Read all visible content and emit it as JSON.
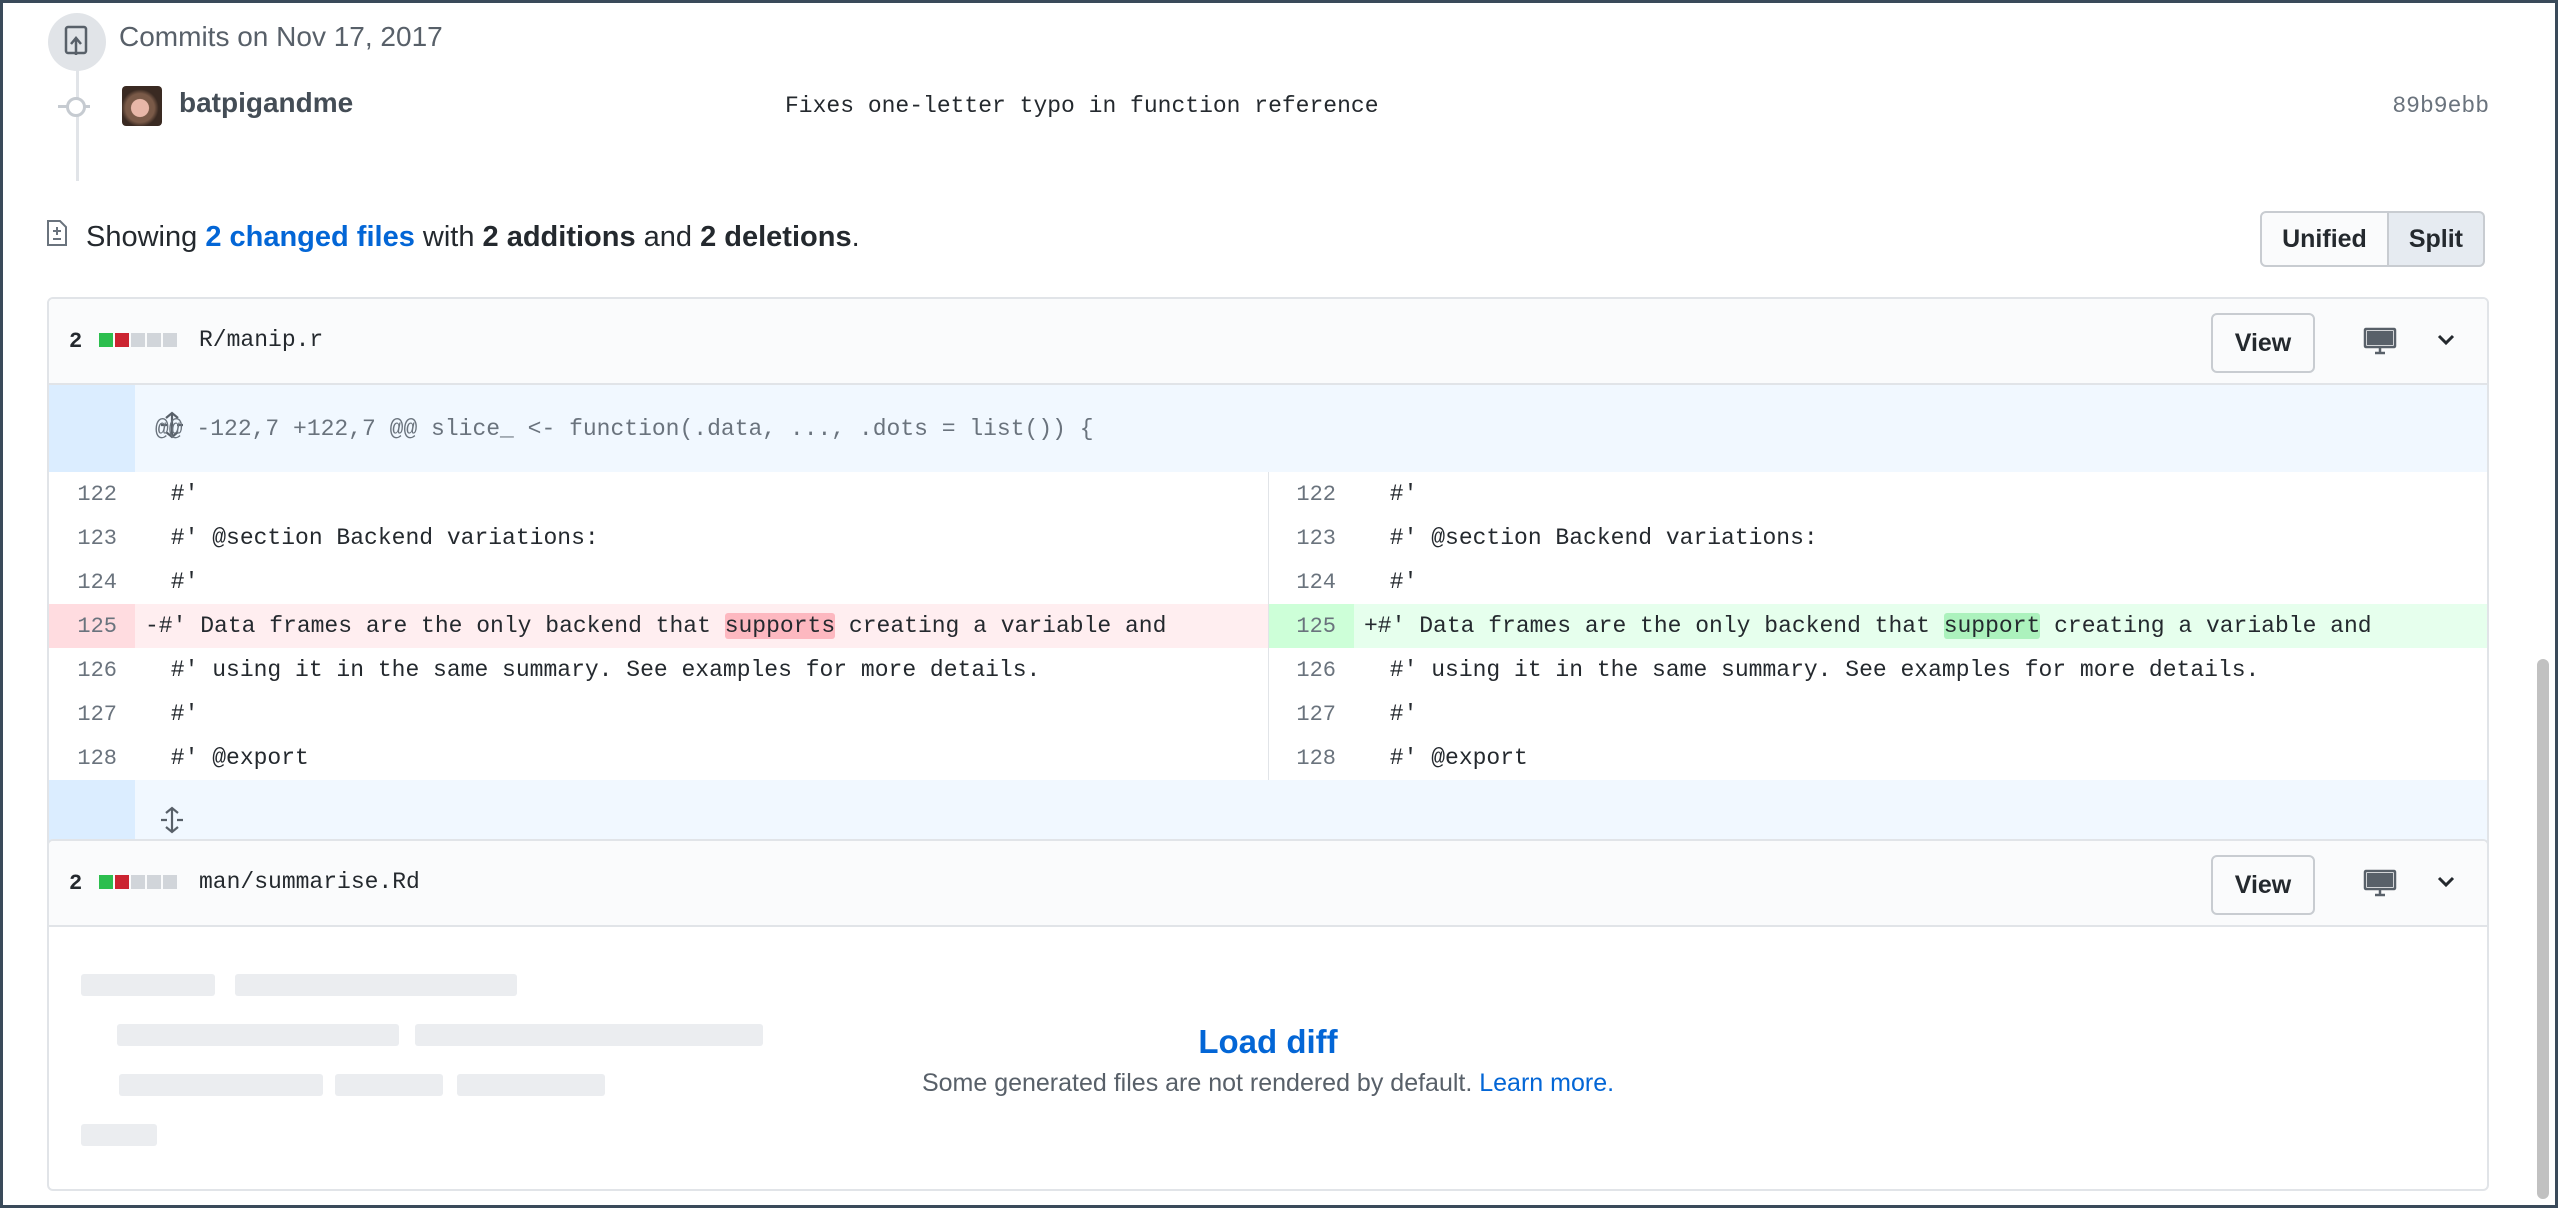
{
  "commits": {
    "date_header": "Commits on Nov 17, 2017",
    "items": [
      {
        "author": "batpigandme",
        "message": "Fixes one-letter typo in function reference",
        "sha": "89b9ebb"
      }
    ]
  },
  "toc": {
    "showing": "Showing ",
    "changed_files": "2 changed files",
    "with": " with ",
    "additions": "2 additions",
    "and": " and ",
    "deletions": "2 deletions",
    "period": "."
  },
  "view_toggle": {
    "unified": "Unified",
    "split": "Split",
    "selected": "Split"
  },
  "files": [
    {
      "count": "2",
      "path": "R/manip.r",
      "view_label": "View",
      "hunk_header": "@@ -122,7 +122,7 @@ slice_ <- function(.data, ..., .dots = list()) {",
      "rows": [
        {
          "l_num": "122",
          "l_code": " #'",
          "r_num": "122",
          "r_code": " #'"
        },
        {
          "l_num": "123",
          "l_code": " #' @section Backend variations:",
          "r_num": "123",
          "r_code": " #' @section Backend variations:"
        },
        {
          "l_num": "124",
          "l_code": " #'",
          "r_num": "124",
          "r_code": " #'"
        },
        {
          "l_num": "125",
          "l_pre": "-#' Data frames are the only backend that ",
          "l_hl": "supports",
          "l_post": " creating a variable and",
          "r_num": "125",
          "r_pre": "+#' Data frames are the only backend that ",
          "r_hl": "support",
          "r_post": " creating a variable and"
        },
        {
          "l_num": "126",
          "l_code": " #' using it in the same summary. See examples for more details.",
          "r_num": "126",
          "r_code": " #' using it in the same summary. See examples for more details."
        },
        {
          "l_num": "127",
          "l_code": " #'",
          "r_num": "127",
          "r_code": " #'"
        },
        {
          "l_num": "128",
          "l_code": " #' @export",
          "r_num": "128",
          "r_code": " #' @export"
        }
      ]
    },
    {
      "count": "2",
      "path": "man/summarise.Rd",
      "view_label": "View",
      "load_diff": "Load diff",
      "note": "Some generated files are not rendered by default. ",
      "learn_more": "Learn more."
    }
  ],
  "icons": {
    "commit_group": "repo-push-icon",
    "file_diff": "file-diff-icon",
    "expand": "unfold-icon",
    "display": "desktop-icon",
    "chevron": "chevron-down-icon"
  },
  "colors": {
    "link": "#0366d6",
    "addition": "#2cbe4e",
    "deletion": "#cb2431",
    "hunk_bg": "#f1f8ff"
  }
}
